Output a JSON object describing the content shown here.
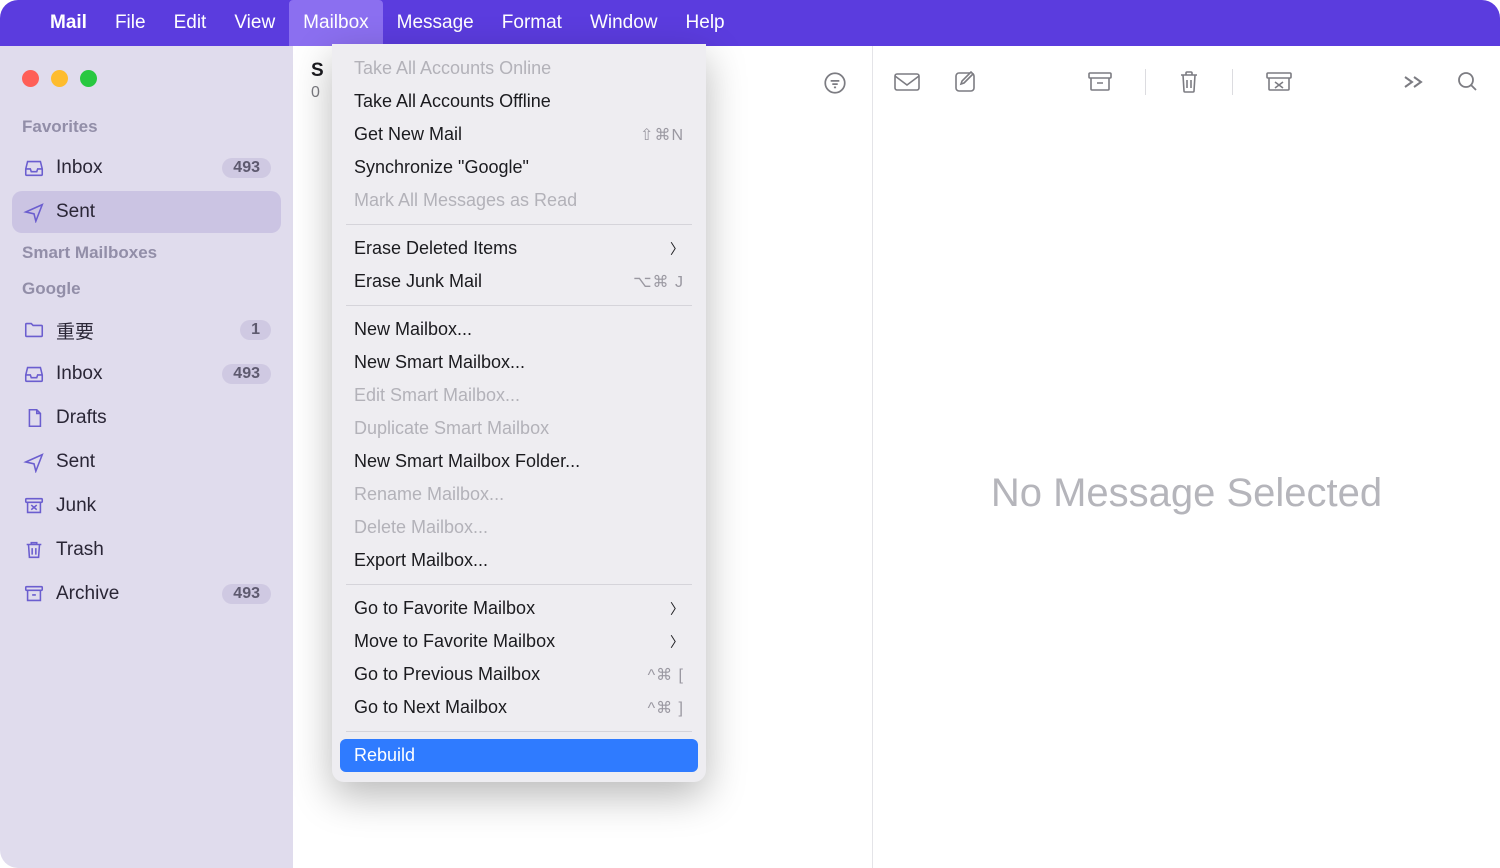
{
  "menubar": {
    "app": "Mail",
    "items": [
      "File",
      "Edit",
      "View",
      "Mailbox",
      "Message",
      "Format",
      "Window",
      "Help"
    ],
    "active": "Mailbox"
  },
  "sidebar": {
    "sections": [
      {
        "label": "Favorites",
        "items": [
          {
            "icon": "inbox",
            "label": "Inbox",
            "badge": "493",
            "selected": false
          },
          {
            "icon": "sent",
            "label": "Sent",
            "badge": "",
            "selected": true
          }
        ]
      },
      {
        "label": "Smart Mailboxes",
        "items": []
      },
      {
        "label": "Google",
        "items": [
          {
            "icon": "folder",
            "label": "重要",
            "badge": "1",
            "selected": false
          },
          {
            "icon": "inbox",
            "label": "Inbox",
            "badge": "493",
            "selected": false
          },
          {
            "icon": "drafts",
            "label": "Drafts",
            "badge": "",
            "selected": false
          },
          {
            "icon": "sent",
            "label": "Sent",
            "badge": "",
            "selected": false
          },
          {
            "icon": "junk",
            "label": "Junk",
            "badge": "",
            "selected": false
          },
          {
            "icon": "trash",
            "label": "Trash",
            "badge": "",
            "selected": false
          },
          {
            "icon": "archive",
            "label": "Archive",
            "badge": "493",
            "selected": false
          }
        ]
      }
    ]
  },
  "messagelist": {
    "title": "S",
    "count": "0"
  },
  "rightpane": {
    "empty": "No Message Selected"
  },
  "dropdown": {
    "groups": [
      [
        {
          "label": "Take All Accounts Online",
          "disabled": true
        },
        {
          "label": "Take All Accounts Offline"
        },
        {
          "label": "Get New Mail",
          "kbd": "⇧⌘N"
        },
        {
          "label": "Synchronize \"Google\""
        },
        {
          "label": "Mark All Messages as Read",
          "disabled": true
        }
      ],
      [
        {
          "label": "Erase Deleted Items",
          "submenu": true
        },
        {
          "label": "Erase Junk Mail",
          "kbd": "⌥⌘ J"
        }
      ],
      [
        {
          "label": "New Mailbox..."
        },
        {
          "label": "New Smart Mailbox..."
        },
        {
          "label": "Edit Smart Mailbox...",
          "disabled": true
        },
        {
          "label": "Duplicate Smart Mailbox",
          "disabled": true
        },
        {
          "label": "New Smart Mailbox Folder..."
        },
        {
          "label": "Rename Mailbox...",
          "disabled": true
        },
        {
          "label": "Delete Mailbox...",
          "disabled": true
        },
        {
          "label": "Export Mailbox..."
        }
      ],
      [
        {
          "label": "Go to Favorite Mailbox",
          "submenu": true
        },
        {
          "label": "Move to Favorite Mailbox",
          "submenu": true
        },
        {
          "label": "Go to Previous Mailbox",
          "kbd": "^⌘ ["
        },
        {
          "label": "Go to Next Mailbox",
          "kbd": "^⌘ ]"
        }
      ],
      [
        {
          "label": "Rebuild",
          "highlight": true
        }
      ]
    ]
  }
}
